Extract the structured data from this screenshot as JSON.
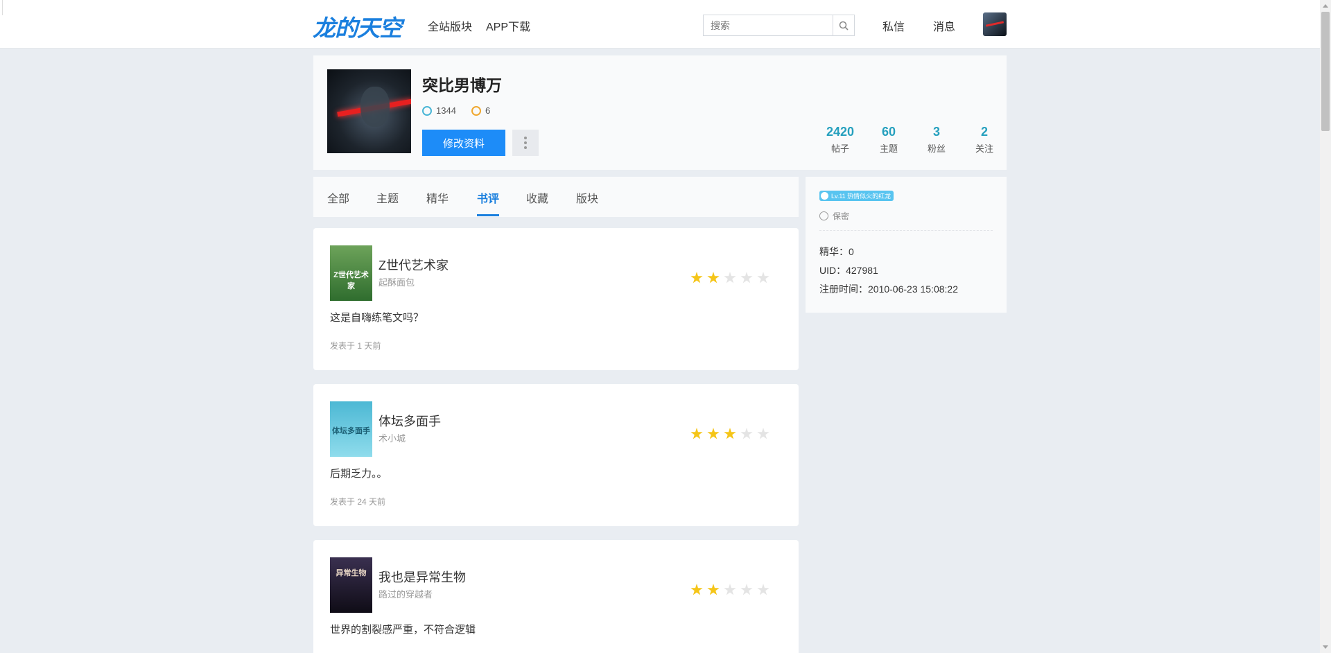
{
  "header": {
    "logo": "龙的天空",
    "nav": [
      "全站版块",
      "APP下载"
    ],
    "search_placeholder": "搜索",
    "messages": "私信",
    "notifications": "消息"
  },
  "profile": {
    "name": "突比男博万",
    "coin_a": "1344",
    "coin_b": "6",
    "edit_label": "修改资料",
    "stats": [
      {
        "num": "2420",
        "label": "帖子"
      },
      {
        "num": "60",
        "label": "主题"
      },
      {
        "num": "3",
        "label": "粉丝"
      },
      {
        "num": "2",
        "label": "关注"
      }
    ]
  },
  "tabs": [
    "全部",
    "主题",
    "精华",
    "书评",
    "收藏",
    "版块"
  ],
  "active_tab": "书评",
  "side": {
    "level_badge": "Lv.11 热情似火的红龙",
    "privacy": "保密",
    "essence": "精华：0",
    "uid": "UID：427981",
    "registered": "注册时间：2010-06-23 15:08:22"
  },
  "reviews": [
    {
      "title": "Z世代艺术家",
      "author": "起酥面包",
      "cover_text": "Z世代艺术家",
      "rating": 2,
      "text": "这是自嗨练笔文吗？",
      "time": "发表于 1 天前"
    },
    {
      "title": "体坛多面手",
      "author": "术小城",
      "cover_text": "体坛多面手",
      "rating": 3,
      "text": "后期乏力。。",
      "time": "发表于 24 天前"
    },
    {
      "title": "我也是异常生物",
      "author": "路过的穿越者",
      "cover_text": "异常生物",
      "rating": 2,
      "text": "世界的割裂感严重，不符合逻辑",
      "time": ""
    }
  ],
  "colors": {
    "accent": "#1a7fde",
    "button": "#1d8cf8",
    "stat": "#26a0be",
    "star": "#f5c518"
  }
}
